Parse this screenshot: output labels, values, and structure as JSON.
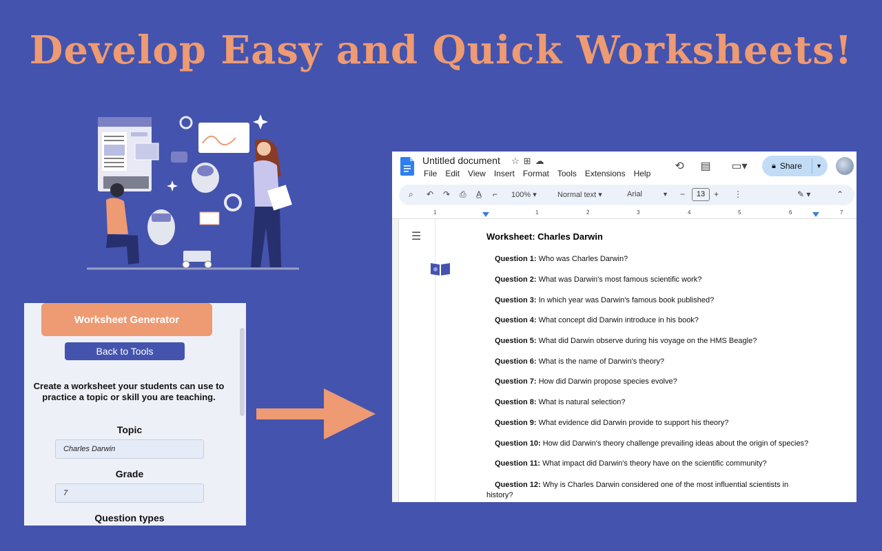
{
  "headline": "Develop Easy and Quick Worksheets!",
  "generator": {
    "title": "Worksheet Generator",
    "back_label": "Back to Tools",
    "description": "Create a worksheet your students can use to practice a topic or skill you are teaching.",
    "topic_label": "Topic",
    "topic_value": "Charles Darwin",
    "grade_label": "Grade",
    "grade_value": "7",
    "question_types_label": "Question types"
  },
  "docs": {
    "doc_title": "Untitled document",
    "menu": [
      "File",
      "Edit",
      "View",
      "Insert",
      "Format",
      "Tools",
      "Extensions",
      "Help"
    ],
    "share_label": "Share",
    "toolbar": {
      "zoom": "100%",
      "style": "Normal text",
      "font": "Arial",
      "font_size": "13"
    },
    "ruler_ticks": [
      "1",
      "1",
      "2",
      "3",
      "4",
      "5",
      "6",
      "7"
    ],
    "worksheet_title": "Worksheet: Charles Darwin",
    "questions": [
      {
        "label": "Question 1:",
        "text": "Who was Charles Darwin?"
      },
      {
        "label": "Question 2:",
        "text": "What was Darwin's most famous scientific work?"
      },
      {
        "label": "Question 3:",
        "text": "In which year was Darwin's famous book published?"
      },
      {
        "label": "Question 4:",
        "text": "What concept did Darwin introduce in his book?"
      },
      {
        "label": "Question 5:",
        "text": "What did Darwin observe during his voyage on the HMS Beagle?"
      },
      {
        "label": "Question 6:",
        "text": "What is the name of Darwin's theory?"
      },
      {
        "label": "Question 7:",
        "text": "How did Darwin propose species evolve?"
      },
      {
        "label": "Question 8:",
        "text": "What is natural selection?"
      },
      {
        "label": "Question 9:",
        "text": "What evidence did Darwin provide to support his theory?"
      },
      {
        "label": "Question 10:",
        "text": "How did Darwin's theory challenge prevailing ideas about the origin of species?"
      },
      {
        "label": "Question 11:",
        "text": "What impact did Darwin's theory have on the scientific community?"
      },
      {
        "label": "Question 12:",
        "text": "Why is Charles Darwin considered one of the most influential scientists in",
        "text_cont": "history?"
      }
    ]
  },
  "colors": {
    "background": "#4453ad",
    "accent": "#ee9a72",
    "button": "#4453ad",
    "share": "#c2dcf6"
  }
}
